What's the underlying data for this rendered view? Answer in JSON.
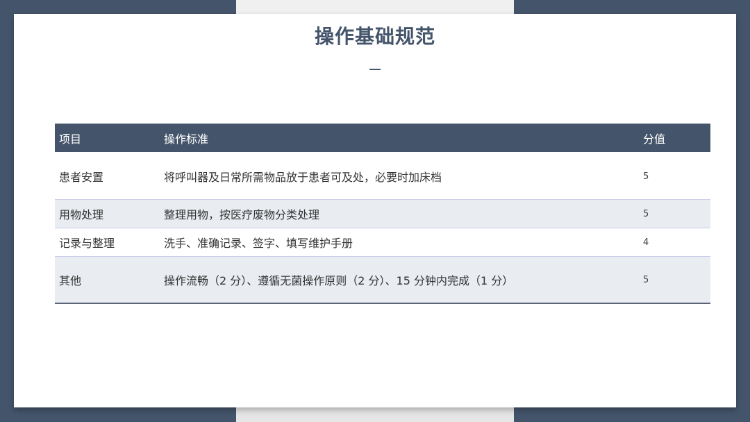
{
  "title": "操作基础规范",
  "title_dash": "—",
  "table": {
    "headers": [
      "项目",
      "操作标准",
      "分值"
    ],
    "rows": [
      {
        "item": "患者安置",
        "standard": "将呼叫器及日常所需物品放于患者可及处，必要时加床档",
        "score": "5"
      },
      {
        "item": "用物处理",
        "standard": "整理用物，按医疗废物分类处理",
        "score": "5"
      },
      {
        "item": "记录与整理",
        "standard": "洗手、准确记录、签字、填写维护手册",
        "score": "4"
      },
      {
        "item": "其他",
        "standard": "操作流畅（2 分）、遵循无菌操作原则（2 分）、15 分钟内完成（1 分）",
        "score": "5"
      }
    ]
  },
  "colors": {
    "frame": "#44546a",
    "header_bg": "#44546a",
    "shaded_row": "#e9ecf1"
  }
}
